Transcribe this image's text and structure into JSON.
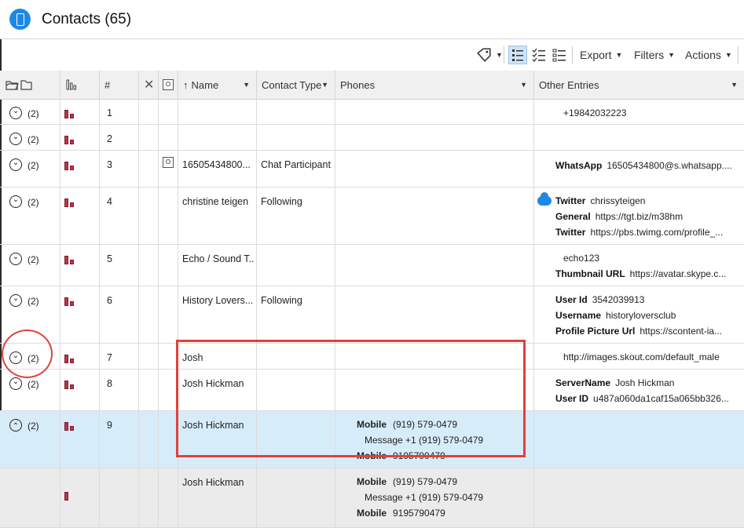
{
  "app": {
    "title": "Contacts (65)"
  },
  "toolbar": {
    "export_label": "Export",
    "filters_label": "Filters",
    "actions_label": "Actions"
  },
  "columns": {
    "index": "#",
    "name": "Name",
    "contact_type": "Contact Type",
    "phones": "Phones",
    "other_entries": "Other Entries"
  },
  "rows": [
    {
      "count": "(2)",
      "index": "1",
      "name": "",
      "type": "",
      "other": [
        {
          "label": "",
          "value": "+19842032223"
        }
      ]
    },
    {
      "count": "(2)",
      "index": "2",
      "name": "",
      "type": "",
      "other": []
    },
    {
      "count": "(2)",
      "index": "3",
      "name": "16505434800...",
      "type": "Chat Participant",
      "other": [
        {
          "label": "WhatsApp",
          "value": "16505434800@s.whatsapp...."
        }
      ]
    },
    {
      "count": "(2)",
      "index": "4",
      "name": "christine teigen",
      "type": "Following",
      "other": [
        {
          "label": "Twitter",
          "value": "chrissyteigen"
        },
        {
          "label": "General",
          "value": "https://tgt.biz/m38hm"
        },
        {
          "label": "Twitter",
          "value": "https://pbs.twimg.com/profile_..."
        }
      ]
    },
    {
      "count": "(2)",
      "index": "5",
      "name": "Echo / Sound T...",
      "type": "",
      "other": [
        {
          "label": "",
          "value": "echo123"
        },
        {
          "label": "Thumbnail URL",
          "value": "https://avatar.skype.c..."
        }
      ]
    },
    {
      "count": "(2)",
      "index": "6",
      "name": "History Lovers...",
      "type": "Following",
      "other": [
        {
          "label": "User Id",
          "value": "3542039913"
        },
        {
          "label": "Username",
          "value": "historyloversclub"
        },
        {
          "label": "Profile Picture Url",
          "value": "https://scontent-ia..."
        }
      ]
    },
    {
      "count": "(2)",
      "index": "7",
      "name": "Josh",
      "type": "",
      "other": [
        {
          "label": "",
          "value": "http://images.skout.com/default_male"
        }
      ]
    },
    {
      "count": "(2)",
      "index": "8",
      "name": "Josh Hickman",
      "type": "",
      "other": [
        {
          "label": "ServerName",
          "value": "Josh Hickman"
        },
        {
          "label": "User ID",
          "value": "u487a060da1caf15a065bb326..."
        }
      ]
    },
    {
      "count": "(2)",
      "index": "9",
      "name": "Josh Hickman",
      "type": "",
      "phones": [
        {
          "label": "Mobile",
          "value": "(919) 579-0479"
        },
        {
          "label": "",
          "value": "Message +1 (919) 579-0479"
        },
        {
          "label": "Mobile",
          "value": "9195790479"
        }
      ]
    },
    {
      "count": "",
      "index": "",
      "name": "Josh Hickman",
      "type": "",
      "phones": [
        {
          "label": "Mobile",
          "value": "(919) 579-0479"
        },
        {
          "label": "",
          "value": "Message +1 (919) 579-0479"
        },
        {
          "label": "Mobile",
          "value": "9195790479"
        }
      ]
    }
  ]
}
